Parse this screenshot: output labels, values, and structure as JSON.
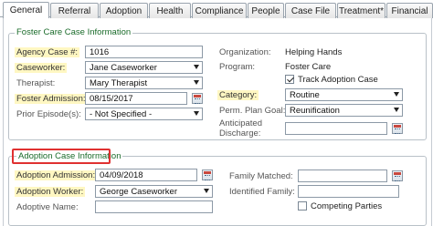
{
  "tabs": [
    {
      "label": "General",
      "active": true
    },
    {
      "label": "Referral"
    },
    {
      "label": "Adoption"
    },
    {
      "label": "Health"
    },
    {
      "label": "Compliance"
    },
    {
      "label": "People"
    },
    {
      "label": "Case File"
    },
    {
      "label": "Treatment*"
    },
    {
      "label": "Financial"
    }
  ],
  "foster": {
    "legend": "Foster Care Case Information",
    "agency_case_label": "Agency Case #:",
    "agency_case_value": "1016",
    "caseworker_label": "Caseworker:",
    "caseworker_value": "Jane Caseworker",
    "therapist_label": "Therapist:",
    "therapist_value": "Mary Therapist",
    "foster_admission_label": "Foster Admission:",
    "foster_admission_value": "08/15/2017",
    "prior_episodes_label": "Prior Episode(s):",
    "prior_episodes_value": "- Not Specified -",
    "organization_label": "Organization:",
    "organization_value": "Helping Hands",
    "program_label": "Program:",
    "program_value": "Foster Care",
    "track_adoption_label": "Track Adoption Case",
    "track_adoption_checked": true,
    "category_label": "Category:",
    "category_value": "Routine",
    "perm_plan_label": "Perm. Plan Goal:",
    "perm_plan_value": "Reunification",
    "anticipated_label_1": "Anticipated",
    "anticipated_label_2": "Discharge:"
  },
  "adoption": {
    "legend": "Adoption Case Information",
    "admission_label": "Adoption Admission:",
    "admission_value": "04/09/2018",
    "worker_label": "Adoption Worker:",
    "worker_value": "George Caseworker",
    "adoptive_name_label": "Adoptive Name:",
    "adoptive_name_value": "",
    "family_matched_label": "Family Matched:",
    "identified_family_label": "Identified Family:",
    "competing_parties_label": "Competing Parties",
    "competing_parties_checked": false
  },
  "colors": {
    "legend_green": "#1a6b2a",
    "required_highlight": "#fff7c2",
    "callout_red": "#e03131"
  }
}
